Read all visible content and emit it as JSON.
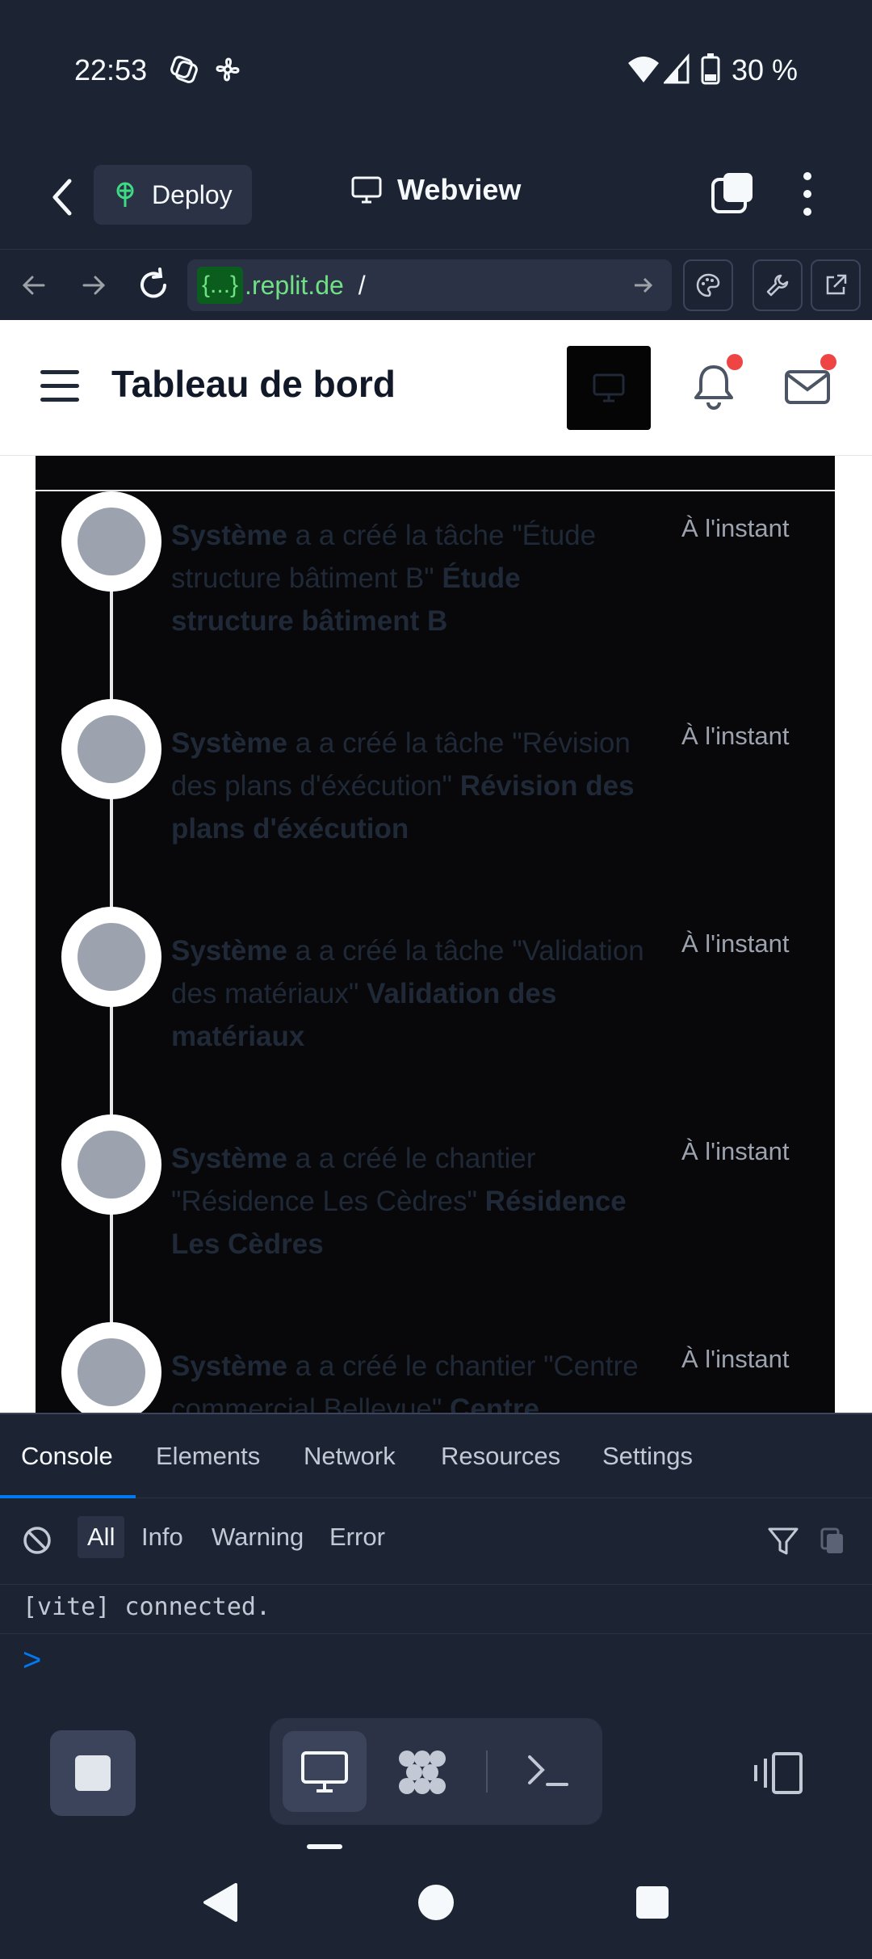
{
  "status_bar": {
    "time": "22:53",
    "battery": "30 %"
  },
  "header": {
    "deploy_label": "Deploy",
    "title": "Webview"
  },
  "url_bar": {
    "badge": "{...}",
    "domain": ".replit.de",
    "path": "/"
  },
  "app": {
    "title": "Tableau de bord"
  },
  "timeline": [
    {
      "actor": "Système",
      "text": " a a créé la tâche \"Étude structure bâtiment B\" ",
      "target": "Étude structure bâtiment B",
      "time": "À l'instant"
    },
    {
      "actor": "Système",
      "text": " a a créé la tâche \"Révision des plans d'éxécution\" ",
      "target": "Révision des plans d'éxécution",
      "time": "À l'instant"
    },
    {
      "actor": "Système",
      "text": " a a créé la tâche \"Validation des matériaux\" ",
      "target": "Validation des matériaux",
      "time": "À l'instant"
    },
    {
      "actor": "Système",
      "text": " a a créé le chantier \"Résidence Les Cèdres\" ",
      "target": "Résidence Les Cèdres",
      "time": "À l'instant"
    },
    {
      "actor": "Système",
      "text": " a a créé le chantier \"Centre commercial Bellevue\" ",
      "target": "Centre",
      "time": "À l'instant"
    }
  ],
  "devtools": {
    "tabs": [
      "Console",
      "Elements",
      "Network",
      "Resources",
      "Settings"
    ],
    "filters": [
      "All",
      "Info",
      "Warning",
      "Error"
    ],
    "log": "[vite] connected.",
    "prompt": ">"
  }
}
